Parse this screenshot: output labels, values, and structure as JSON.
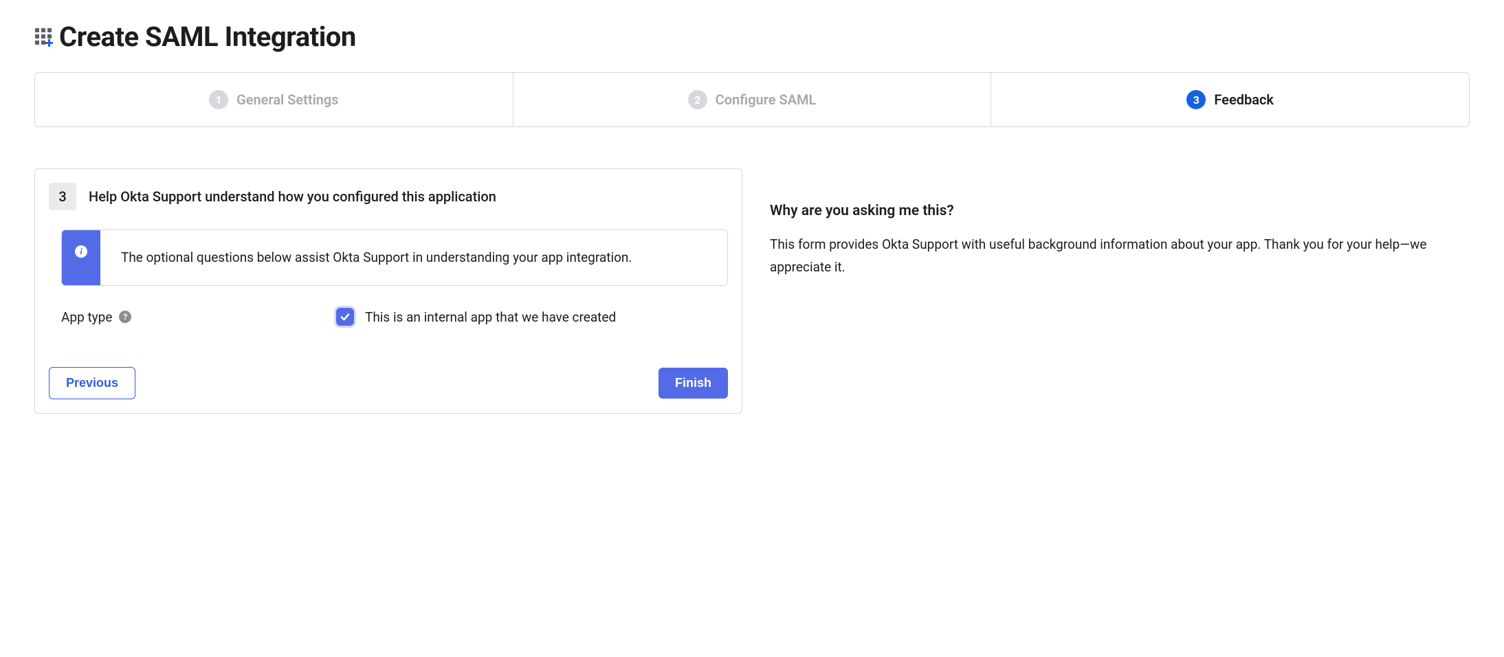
{
  "header": {
    "title": "Create SAML Integration"
  },
  "wizard": {
    "steps": [
      {
        "num": "1",
        "label": "General Settings",
        "active": false
      },
      {
        "num": "2",
        "label": "Configure SAML",
        "active": false
      },
      {
        "num": "3",
        "label": "Feedback",
        "active": true
      }
    ]
  },
  "panel": {
    "step_badge": "3",
    "title": "Help Okta Support understand how you configured this application",
    "info": "The optional questions below assist Okta Support in understanding your app integration.",
    "app_type": {
      "label": "App type",
      "checkbox_label": "This is an internal app that we have created",
      "checked": true
    },
    "buttons": {
      "previous": "Previous",
      "finish": "Finish"
    }
  },
  "aside": {
    "title": "Why are you asking me this?",
    "body": "This form provides Okta Support with useful background information about your app. Thank you for your help—we appreciate it."
  }
}
